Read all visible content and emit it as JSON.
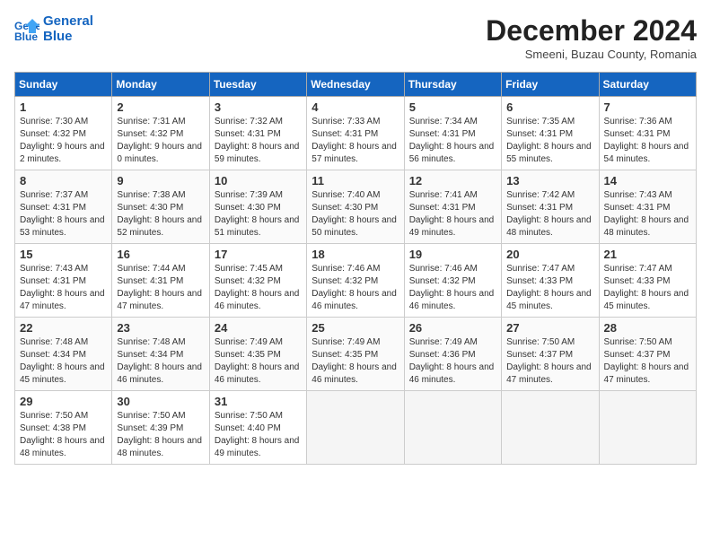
{
  "header": {
    "logo_line1": "General",
    "logo_line2": "Blue",
    "month_title": "December 2024",
    "subtitle": "Smeeni, Buzau County, Romania"
  },
  "weekdays": [
    "Sunday",
    "Monday",
    "Tuesday",
    "Wednesday",
    "Thursday",
    "Friday",
    "Saturday"
  ],
  "weeks": [
    [
      {
        "day": "1",
        "sunrise": "Sunrise: 7:30 AM",
        "sunset": "Sunset: 4:32 PM",
        "daylight": "Daylight: 9 hours and 2 minutes."
      },
      {
        "day": "2",
        "sunrise": "Sunrise: 7:31 AM",
        "sunset": "Sunset: 4:32 PM",
        "daylight": "Daylight: 9 hours and 0 minutes."
      },
      {
        "day": "3",
        "sunrise": "Sunrise: 7:32 AM",
        "sunset": "Sunset: 4:31 PM",
        "daylight": "Daylight: 8 hours and 59 minutes."
      },
      {
        "day": "4",
        "sunrise": "Sunrise: 7:33 AM",
        "sunset": "Sunset: 4:31 PM",
        "daylight": "Daylight: 8 hours and 57 minutes."
      },
      {
        "day": "5",
        "sunrise": "Sunrise: 7:34 AM",
        "sunset": "Sunset: 4:31 PM",
        "daylight": "Daylight: 8 hours and 56 minutes."
      },
      {
        "day": "6",
        "sunrise": "Sunrise: 7:35 AM",
        "sunset": "Sunset: 4:31 PM",
        "daylight": "Daylight: 8 hours and 55 minutes."
      },
      {
        "day": "7",
        "sunrise": "Sunrise: 7:36 AM",
        "sunset": "Sunset: 4:31 PM",
        "daylight": "Daylight: 8 hours and 54 minutes."
      }
    ],
    [
      {
        "day": "8",
        "sunrise": "Sunrise: 7:37 AM",
        "sunset": "Sunset: 4:31 PM",
        "daylight": "Daylight: 8 hours and 53 minutes."
      },
      {
        "day": "9",
        "sunrise": "Sunrise: 7:38 AM",
        "sunset": "Sunset: 4:30 PM",
        "daylight": "Daylight: 8 hours and 52 minutes."
      },
      {
        "day": "10",
        "sunrise": "Sunrise: 7:39 AM",
        "sunset": "Sunset: 4:30 PM",
        "daylight": "Daylight: 8 hours and 51 minutes."
      },
      {
        "day": "11",
        "sunrise": "Sunrise: 7:40 AM",
        "sunset": "Sunset: 4:30 PM",
        "daylight": "Daylight: 8 hours and 50 minutes."
      },
      {
        "day": "12",
        "sunrise": "Sunrise: 7:41 AM",
        "sunset": "Sunset: 4:31 PM",
        "daylight": "Daylight: 8 hours and 49 minutes."
      },
      {
        "day": "13",
        "sunrise": "Sunrise: 7:42 AM",
        "sunset": "Sunset: 4:31 PM",
        "daylight": "Daylight: 8 hours and 48 minutes."
      },
      {
        "day": "14",
        "sunrise": "Sunrise: 7:43 AM",
        "sunset": "Sunset: 4:31 PM",
        "daylight": "Daylight: 8 hours and 48 minutes."
      }
    ],
    [
      {
        "day": "15",
        "sunrise": "Sunrise: 7:43 AM",
        "sunset": "Sunset: 4:31 PM",
        "daylight": "Daylight: 8 hours and 47 minutes."
      },
      {
        "day": "16",
        "sunrise": "Sunrise: 7:44 AM",
        "sunset": "Sunset: 4:31 PM",
        "daylight": "Daylight: 8 hours and 47 minutes."
      },
      {
        "day": "17",
        "sunrise": "Sunrise: 7:45 AM",
        "sunset": "Sunset: 4:32 PM",
        "daylight": "Daylight: 8 hours and 46 minutes."
      },
      {
        "day": "18",
        "sunrise": "Sunrise: 7:46 AM",
        "sunset": "Sunset: 4:32 PM",
        "daylight": "Daylight: 8 hours and 46 minutes."
      },
      {
        "day": "19",
        "sunrise": "Sunrise: 7:46 AM",
        "sunset": "Sunset: 4:32 PM",
        "daylight": "Daylight: 8 hours and 46 minutes."
      },
      {
        "day": "20",
        "sunrise": "Sunrise: 7:47 AM",
        "sunset": "Sunset: 4:33 PM",
        "daylight": "Daylight: 8 hours and 45 minutes."
      },
      {
        "day": "21",
        "sunrise": "Sunrise: 7:47 AM",
        "sunset": "Sunset: 4:33 PM",
        "daylight": "Daylight: 8 hours and 45 minutes."
      }
    ],
    [
      {
        "day": "22",
        "sunrise": "Sunrise: 7:48 AM",
        "sunset": "Sunset: 4:34 PM",
        "daylight": "Daylight: 8 hours and 45 minutes."
      },
      {
        "day": "23",
        "sunrise": "Sunrise: 7:48 AM",
        "sunset": "Sunset: 4:34 PM",
        "daylight": "Daylight: 8 hours and 46 minutes."
      },
      {
        "day": "24",
        "sunrise": "Sunrise: 7:49 AM",
        "sunset": "Sunset: 4:35 PM",
        "daylight": "Daylight: 8 hours and 46 minutes."
      },
      {
        "day": "25",
        "sunrise": "Sunrise: 7:49 AM",
        "sunset": "Sunset: 4:35 PM",
        "daylight": "Daylight: 8 hours and 46 minutes."
      },
      {
        "day": "26",
        "sunrise": "Sunrise: 7:49 AM",
        "sunset": "Sunset: 4:36 PM",
        "daylight": "Daylight: 8 hours and 46 minutes."
      },
      {
        "day": "27",
        "sunrise": "Sunrise: 7:50 AM",
        "sunset": "Sunset: 4:37 PM",
        "daylight": "Daylight: 8 hours and 47 minutes."
      },
      {
        "day": "28",
        "sunrise": "Sunrise: 7:50 AM",
        "sunset": "Sunset: 4:37 PM",
        "daylight": "Daylight: 8 hours and 47 minutes."
      }
    ],
    [
      {
        "day": "29",
        "sunrise": "Sunrise: 7:50 AM",
        "sunset": "Sunset: 4:38 PM",
        "daylight": "Daylight: 8 hours and 48 minutes."
      },
      {
        "day": "30",
        "sunrise": "Sunrise: 7:50 AM",
        "sunset": "Sunset: 4:39 PM",
        "daylight": "Daylight: 8 hours and 48 minutes."
      },
      {
        "day": "31",
        "sunrise": "Sunrise: 7:50 AM",
        "sunset": "Sunset: 4:40 PM",
        "daylight": "Daylight: 8 hours and 49 minutes."
      },
      null,
      null,
      null,
      null
    ]
  ]
}
